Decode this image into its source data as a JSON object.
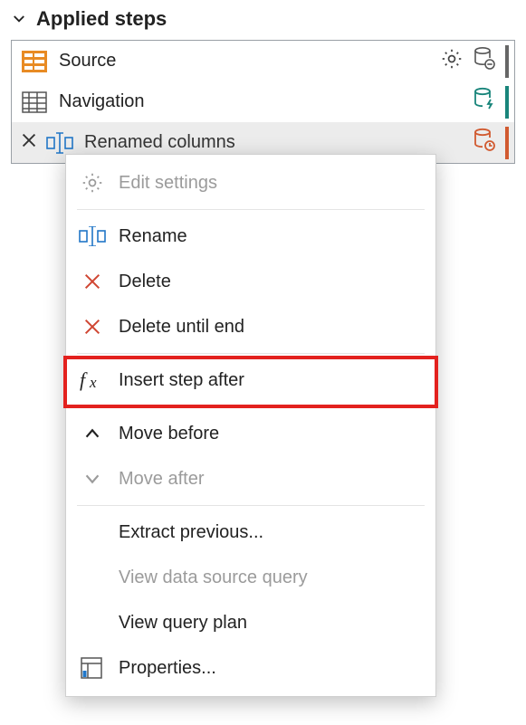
{
  "header": {
    "title": "Applied steps"
  },
  "steps": [
    {
      "label": "Source"
    },
    {
      "label": "Navigation"
    },
    {
      "label": "Renamed columns"
    }
  ],
  "menu": {
    "edit_settings": "Edit settings",
    "rename": "Rename",
    "delete": "Delete",
    "delete_until_end": "Delete until end",
    "insert_step_after": "Insert step after",
    "move_before": "Move before",
    "move_after": "Move after",
    "extract_previous": "Extract previous...",
    "view_data_source_query": "View data source query",
    "view_query_plan": "View query plan",
    "properties": "Properties..."
  }
}
